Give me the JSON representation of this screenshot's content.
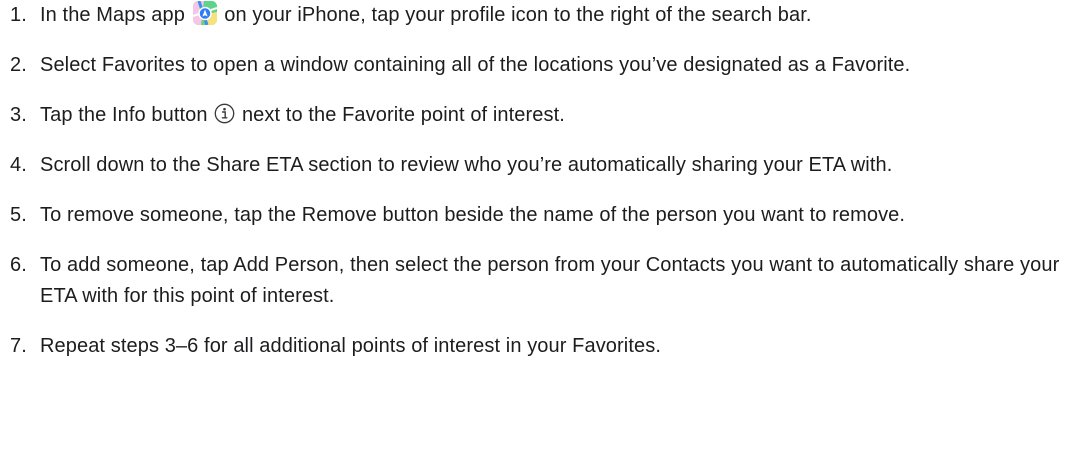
{
  "steps": [
    {
      "number": "1.",
      "text_before": "In the Maps app",
      "icon": "maps-app-icon",
      "text_after": "on your iPhone, tap your profile icon to the right of the search bar."
    },
    {
      "number": "2.",
      "text": "Select Favorites to open a window containing all of the locations you’ve designated as a Favorite."
    },
    {
      "number": "3.",
      "text_before": "Tap the Info button",
      "icon": "info-icon",
      "text_after": "next to the Favorite point of interest."
    },
    {
      "number": "4.",
      "text": "Scroll down to the Share ETA section to review who you’re automatically sharing your ETA with."
    },
    {
      "number": "5.",
      "text": "To remove someone, tap the Remove button beside the name of the person you want to remove."
    },
    {
      "number": "6.",
      "text": "To add someone, tap Add Person, then select the person from your Contacts you want to automatically share your ETA with for this point of interest."
    },
    {
      "number": "7.",
      "text": "Repeat steps 3–6 for all additional points of interest in your Favorites."
    }
  ]
}
